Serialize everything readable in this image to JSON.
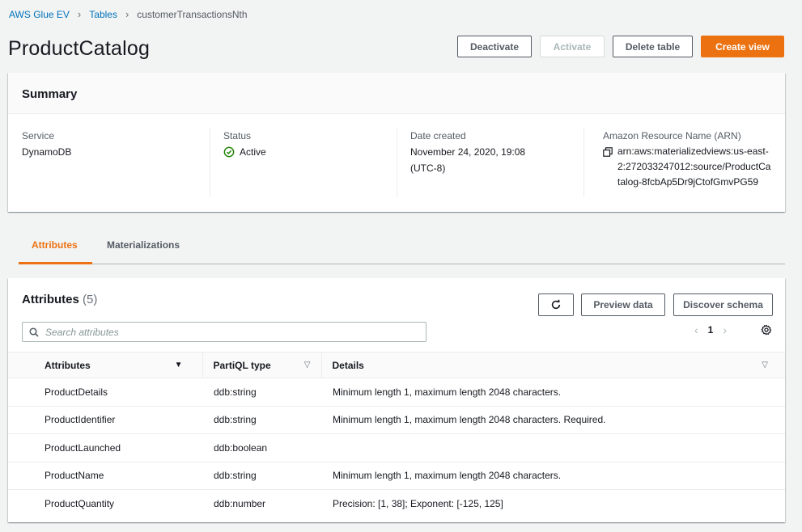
{
  "breadcrumb": {
    "items": [
      "AWS Glue EV",
      "Tables"
    ],
    "current": "customerTransactionsNth"
  },
  "header": {
    "title": "ProductCatalog",
    "deactivate": "Deactivate",
    "activate": "Activate",
    "delete_table": "Delete table",
    "create_view": "Create view"
  },
  "summary": {
    "heading": "Summary",
    "service_label": "Service",
    "service_value": "DynamoDB",
    "status_label": "Status",
    "status_value": "Active",
    "date_label": "Date created",
    "date_value": "November 24, 2020, 19:08 (UTC-8)",
    "arn_label": "Amazon Resource Name (ARN)",
    "arn_value": "arn:aws:materializedviews:us-east-2:272033247012:source/ProductCatalog-8fcbAp5Dr9jCtofGmvPG59"
  },
  "tabs": {
    "attributes": "Attributes",
    "materializations": "Materializations"
  },
  "attributes_panel": {
    "title": "Attributes",
    "count": "(5)",
    "preview_data": "Preview data",
    "discover_schema": "Discover schema",
    "search_placeholder": "Search attributes",
    "page": "1",
    "columns": [
      "Attributes",
      "PartiQL type",
      "Details"
    ],
    "rows": [
      {
        "name": "ProductDetails",
        "type": "ddb:string",
        "details": "Minimum length 1, maximum length 2048 characters."
      },
      {
        "name": "ProductIdentifier",
        "type": "ddb:string",
        "details": "Minimum length 1, maximum length 2048 characters. Required."
      },
      {
        "name": "ProductLaunched",
        "type": "ddb:boolean",
        "details": ""
      },
      {
        "name": "ProductName",
        "type": "ddb:string",
        "details": "Minimum length 1, maximum length 2048 characters."
      },
      {
        "name": "ProductQuantity",
        "type": "ddb:number",
        "details": "Precision: [1, 38]; Exponent: [-125, 125]"
      }
    ]
  },
  "colors": {
    "link": "#0073bb",
    "accent": "#ec7211",
    "success": "#1d8102"
  }
}
